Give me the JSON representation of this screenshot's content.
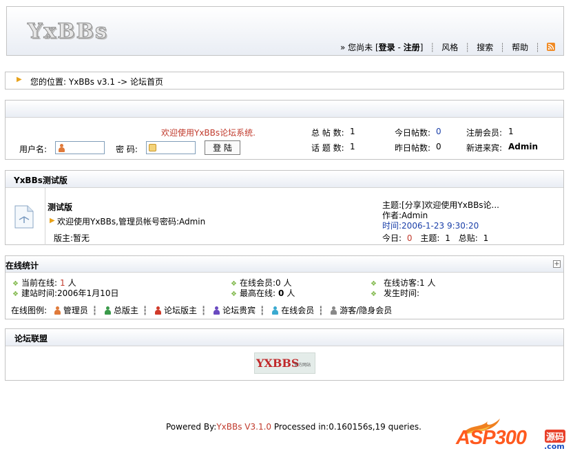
{
  "header": {
    "logo_text": "YxBBs",
    "not_logged": "» 您尚未",
    "bracket_open": "[",
    "login": "登录",
    "dash": "-",
    "register": "注册",
    "bracket_close": "]",
    "nav": [
      "风格",
      "搜索",
      "帮助"
    ]
  },
  "breadcrumb": {
    "text": "您的位置: YxBBs v3.1 -> 论坛首页"
  },
  "login_box": {
    "welcome": "欢迎使用YxBBs论坛系统.",
    "username_label": "用户名:",
    "password_label": "密 码:",
    "login_button": "登 陆",
    "stats": {
      "total_posts_label": "总 帖 数:",
      "total_posts": "1",
      "topics_label": "话 题 数:",
      "topics": "1",
      "today_label": "今日帖数:",
      "today": "0",
      "yesterday_label": "昨日帖数:",
      "yesterday": "0",
      "members_label": "注册会员:",
      "members": "1",
      "newest_label": "新进来宾:",
      "newest": "Admin"
    }
  },
  "forum_section": {
    "title": "YxBBs测试版",
    "board_name": "测试版",
    "board_desc": "欢迎使用YxBBs,管理员帐号密码:Admin",
    "moderator": "版主:暂无",
    "topic": "主题:[分享]欢迎使用YxBBs论...",
    "author": "作者:Admin",
    "time": "时间:2006-1-23 9:30:20",
    "today_label": "今日:",
    "today_value": "0",
    "topics_label": "主题:",
    "topics_value": "1",
    "total_label": "总贴:",
    "total_value": "1"
  },
  "online": {
    "title": "在线统计",
    "current_label": "当前在线:",
    "current_value": "1",
    "current_unit": "人",
    "members": "在线会员:0 人",
    "visitors": "在线访客:1 人",
    "founded": "建站时间:2006年1月10日",
    "max_label": "最高在线:",
    "max_value": "0",
    "max_unit": "人",
    "occurred": "发生时间:",
    "legend_label": "在线图例:",
    "legend": [
      {
        "label": "管理员",
        "color": "#e07a3a"
      },
      {
        "label": "总版主",
        "color": "#3a9a4a"
      },
      {
        "label": "论坛版主",
        "color": "#d03a2a"
      },
      {
        "label": "论坛贵宾",
        "color": "#6a4ac0"
      },
      {
        "label": "在线会员",
        "color": "#3aaad0"
      },
      {
        "label": "游客/隐身会员",
        "color": "#888888"
      }
    ]
  },
  "alliance": {
    "title": "论坛联盟",
    "badge_text": "YXBBS",
    "badge_sub": "官方网站"
  },
  "footer": {
    "powered_by": "Powered By:",
    "version": "YxBBs V3.1.0",
    "processed": " Processed in:0.160156s,19 queries."
  },
  "watermark": {
    "text": "ASP300",
    "badge": "源码",
    "domain": ".com"
  }
}
